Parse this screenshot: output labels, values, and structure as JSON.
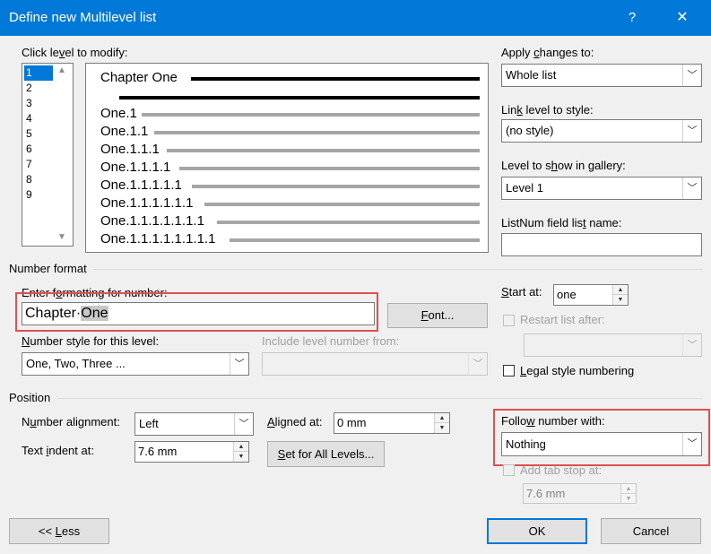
{
  "window": {
    "title": "Define new Multilevel list",
    "help": "?",
    "close": "✕"
  },
  "levels": {
    "label_pre": "Click le",
    "label_u": "v",
    "label_post": "el to modify:",
    "items": [
      "1",
      "2",
      "3",
      "4",
      "5",
      "6",
      "7",
      "8",
      "9"
    ],
    "selected": "1"
  },
  "preview": {
    "lines": [
      "Chapter One",
      "One.1",
      "One.1.1",
      "One.1.1.1",
      "One.1.1.1.1",
      "One.1.1.1.1.1",
      "One.1.1.1.1.1.1",
      "One.1.1.1.1.1.1.1",
      "One.1.1.1.1.1.1.1.1"
    ]
  },
  "apply_changes": {
    "label_pre": "Apply ",
    "label_u": "c",
    "label_post": "hanges to:",
    "value": "Whole list"
  },
  "link_level": {
    "label_pre": "Lin",
    "label_u": "k",
    "label_post": " level to style:",
    "value": "(no style)"
  },
  "gallery_level": {
    "label_pre": "Level to s",
    "label_u": "h",
    "label_post": "ow in gallery:",
    "value": "Level 1"
  },
  "listnum": {
    "label_pre": "ListNum field lis",
    "label_u": "t",
    "label_post": " name:",
    "value": ""
  },
  "number_format": {
    "section": "Number format",
    "enter_label_pre": "Enter f",
    "enter_label_u": "o",
    "enter_label_post": "rmatting for number:",
    "format_prefix": "Chapter·",
    "format_selected": "One",
    "font_button_u": "F",
    "font_button_post": "ont...",
    "style_label_u": "N",
    "style_label_post": "umber style for this level:",
    "style_value": "One, Two, Three ...",
    "include_label": "Include level number from:",
    "include_value": ""
  },
  "start_at": {
    "label_u": "S",
    "label_post": "tart at:",
    "value": "one"
  },
  "restart": {
    "label": "Restart list after:",
    "value": ""
  },
  "legal": {
    "label_u": "L",
    "label_post": "egal style numbering"
  },
  "position": {
    "section": "Position",
    "alignment_label_pre": "N",
    "alignment_label_u": "u",
    "alignment_label_post": "mber alignment:",
    "alignment_value": "Left",
    "aligned_at_label_pre": "",
    "aligned_at_label_u": "A",
    "aligned_at_label_post": "ligned at:",
    "aligned_at_value": "0 mm",
    "indent_label_pre": "Text ",
    "indent_label_u": "i",
    "indent_label_post": "ndent at:",
    "indent_value": "7.6 mm",
    "set_all_u": "S",
    "set_all_post": "et for All Levels..."
  },
  "follow": {
    "label_pre": "Follo",
    "label_u": "w",
    "label_post": " number with:",
    "value": "Nothing"
  },
  "add_tab": {
    "label": "Add tab stop at:",
    "value": "7.6 mm"
  },
  "buttons": {
    "less_pre": "<< ",
    "less_u": "L",
    "less_post": "ess",
    "ok": "OK",
    "cancel": "Cancel"
  },
  "colors": {
    "titlebar": "#0078d7",
    "highlight": "#e05050",
    "selection": "#0078d7"
  }
}
